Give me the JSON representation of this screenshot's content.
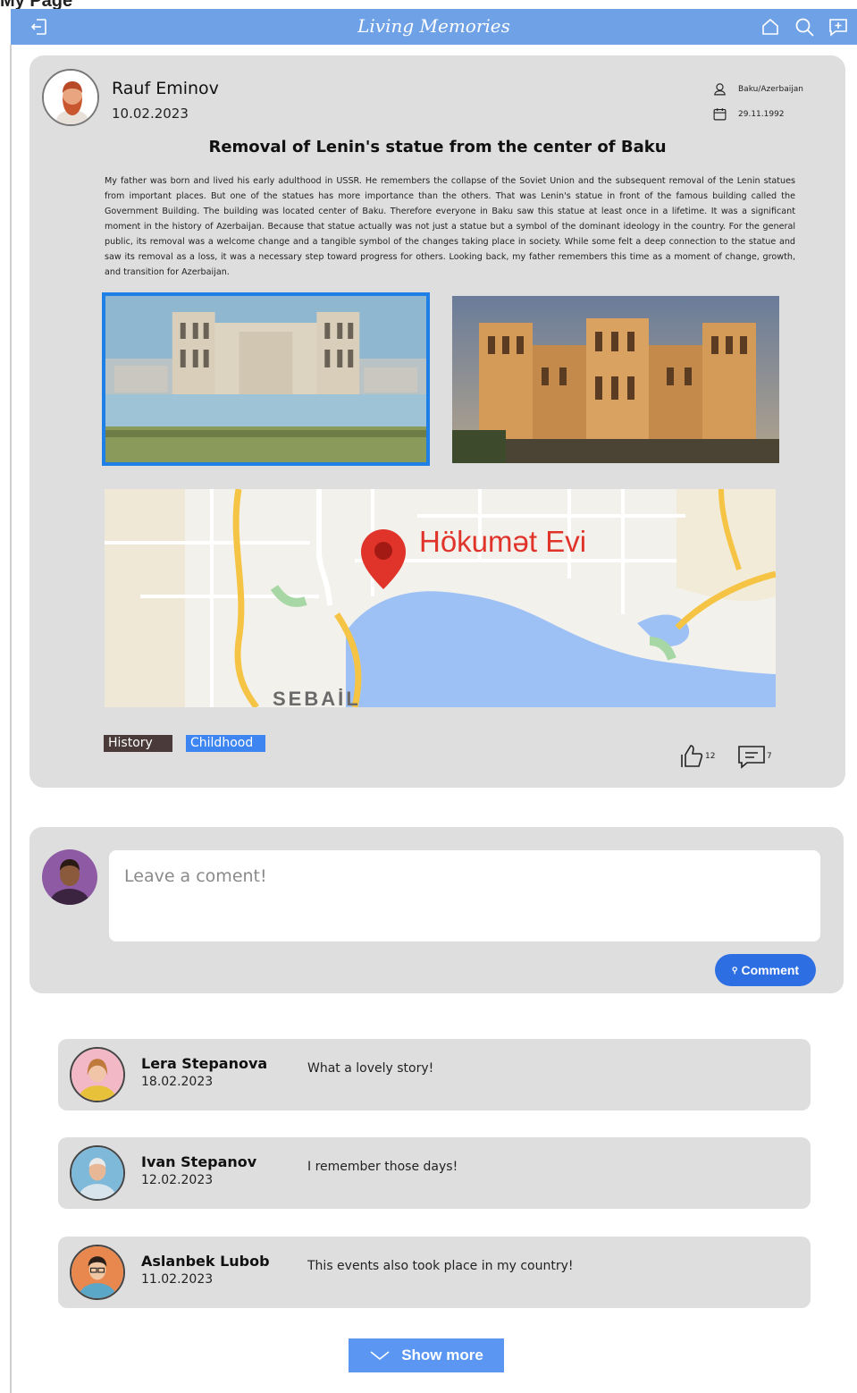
{
  "page": {
    "caption": "My Page"
  },
  "appbar": {
    "title": "Living Memories",
    "icons": [
      "logout-icon",
      "home-icon",
      "search-icon",
      "add-post-icon"
    ]
  },
  "post": {
    "author": {
      "name": "Rauf Eminov",
      "date": "10.02.2023"
    },
    "location": "Baku/Azerbaijan",
    "birth_date": "29.11.1992",
    "title": "Removal of Lenin's statue from the center of Baku",
    "body": "My father was born and lived his early adulthood in USSR. He remembers the collapse of the Soviet Union and the subsequent removal of the Lenin statues from important places. But one of the statues has more importance than the others. That was Lenin's statue in front of the famous building called the Government Building. The building was located center of Baku. Therefore everyone in Baku saw this statue at least once in a lifetime. It was a significant moment in the history of Azerbaijan. Because that statue actually was not just a statue but a symbol of the dominant ideology in the country. For the general public, its removal was a welcome change and a tangible symbol of the changes taking place in society. While some felt a deep connection to the statue and saw its removal as a loss, it was a necessary step toward progress for others. Looking back, my father remembers this time as a moment of change, growth, and transition for Azerbaijan.",
    "map": {
      "place": "Hökumət Evi",
      "district": "SEBAİL"
    },
    "tags": [
      "History",
      "Childhood"
    ],
    "likes": "12",
    "comments_count": "7"
  },
  "composer": {
    "placeholder": "Leave a coment!",
    "button_label": "Comment"
  },
  "comments": [
    {
      "name": "Lera Stepanova",
      "date": "18.02.2023",
      "text": "What a lovely story!"
    },
    {
      "name": "Ivan Stepanov",
      "date": "12.02.2023",
      "text": "I remember those days!"
    },
    {
      "name": "Aslanbek Lubob",
      "date": "11.02.2023",
      "text": "This events also took place in my country!"
    }
  ],
  "show_more_label": "Show more",
  "colors": {
    "appbar": "#6fa1e6",
    "accent": "#2d6fe3",
    "card": "#dedede",
    "tag_history": "#4a3a3a",
    "tag_childhood": "#3d86f2"
  }
}
